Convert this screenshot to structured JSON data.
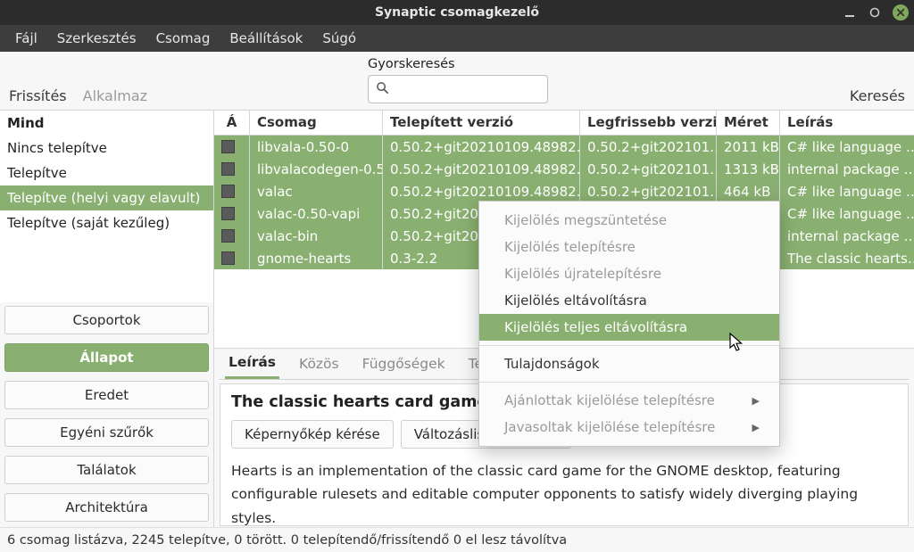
{
  "window": {
    "title": "Synaptic csomagkezelő"
  },
  "menu": {
    "items": [
      "Fájl",
      "Szerkesztés",
      "Csomag",
      "Beállítások",
      "Súgó"
    ]
  },
  "toolbar": {
    "refresh": "Frissítés",
    "apply": "Alkalmaz",
    "quicksearch_label": "Gyorskeresés",
    "search": "Keresés"
  },
  "status_list": {
    "items": [
      {
        "label": "Mind",
        "bold": true,
        "selected": false
      },
      {
        "label": "Nincs telepítve",
        "bold": false,
        "selected": false
      },
      {
        "label": "Telepítve",
        "bold": false,
        "selected": false
      },
      {
        "label": "Telepítve (helyi vagy elavult)",
        "bold": false,
        "selected": true
      },
      {
        "label": "Telepítve (saját kezűleg)",
        "bold": false,
        "selected": false
      }
    ]
  },
  "side_buttons": {
    "items": [
      {
        "label": "Csoportok",
        "active": false
      },
      {
        "label": "Állapot",
        "active": true
      },
      {
        "label": "Eredet",
        "active": false
      },
      {
        "label": "Egyéni szűrők",
        "active": false
      },
      {
        "label": "Találatok",
        "active": false
      },
      {
        "label": "Architektúra",
        "active": false
      }
    ]
  },
  "table": {
    "headers": {
      "status": "Á",
      "package": "Csomag",
      "installed": "Telepített verzió",
      "latest": "Legfrissebb verzió",
      "size": "Méret",
      "desc": "Leírás"
    },
    "rows": [
      {
        "package": "libvala-0.50-0",
        "installed": "0.50.2+git20210109.48982…",
        "latest": "0.50.2+git202101…",
        "size": "2011 kB",
        "desc": "C# like language …"
      },
      {
        "package": "libvalacodegen-0.5…",
        "installed": "0.50.2+git20210109.48982…",
        "latest": "0.50.2+git202101…",
        "size": "1313 kB",
        "desc": "internal package …"
      },
      {
        "package": "valac",
        "installed": "0.50.2+git20210109.48982…",
        "latest": "0.50.2+git202101…",
        "size": "464 kB",
        "desc": "C# like language …"
      },
      {
        "package": "valac-0.50-vapi",
        "installed": "0.50.2+git20…",
        "latest": "",
        "size": "…",
        "desc": "C# like language …"
      },
      {
        "package": "valac-bin",
        "installed": "0.50.2+git20…",
        "latest": "",
        "size": "…",
        "desc": "internal package …"
      },
      {
        "package": "gnome-hearts",
        "installed": "0.3-2.2",
        "latest": "",
        "size": "…",
        "desc": "The classic hearts…"
      }
    ]
  },
  "detail": {
    "tabs": [
      "Leírás",
      "Közös",
      "Függőségek",
      "Tele…"
    ],
    "title": "The classic hearts card game for the GNOME desktop",
    "btn_screenshot": "Képernyőkép kérése",
    "btn_changelog": "Változáslista lekérése",
    "text": "Hearts is an implementation of the classic card game for the GNOME desktop, featuring configurable rulesets and editable computer opponents to satisfy widely diverging playing styles."
  },
  "context_menu": {
    "items": [
      {
        "label": "Kijelölés megszüntetése",
        "dim": true
      },
      {
        "label": "Kijelölés telepítésre",
        "dim": true
      },
      {
        "label": "Kijelölés újratelepítésre",
        "dim": true
      },
      {
        "label": "Kijelölés eltávolításra",
        "dim": false
      },
      {
        "label": "Kijelölés teljes eltávolításra",
        "dim": false,
        "hl": true
      },
      {
        "sep": true
      },
      {
        "label": "Tulajdonságok",
        "dim": false
      },
      {
        "sep": true
      },
      {
        "label": "Ajánlottak kijelölése telepítésre",
        "dim": true,
        "sub": true
      },
      {
        "label": "Javasoltak kijelölése telepítésre",
        "dim": true,
        "sub": true
      }
    ]
  },
  "statusbar": {
    "text": "6 csomag listázva, 2245 telepítve, 0 törött. 0 telepítendő/frissítendő 0 el lesz távolítva"
  }
}
